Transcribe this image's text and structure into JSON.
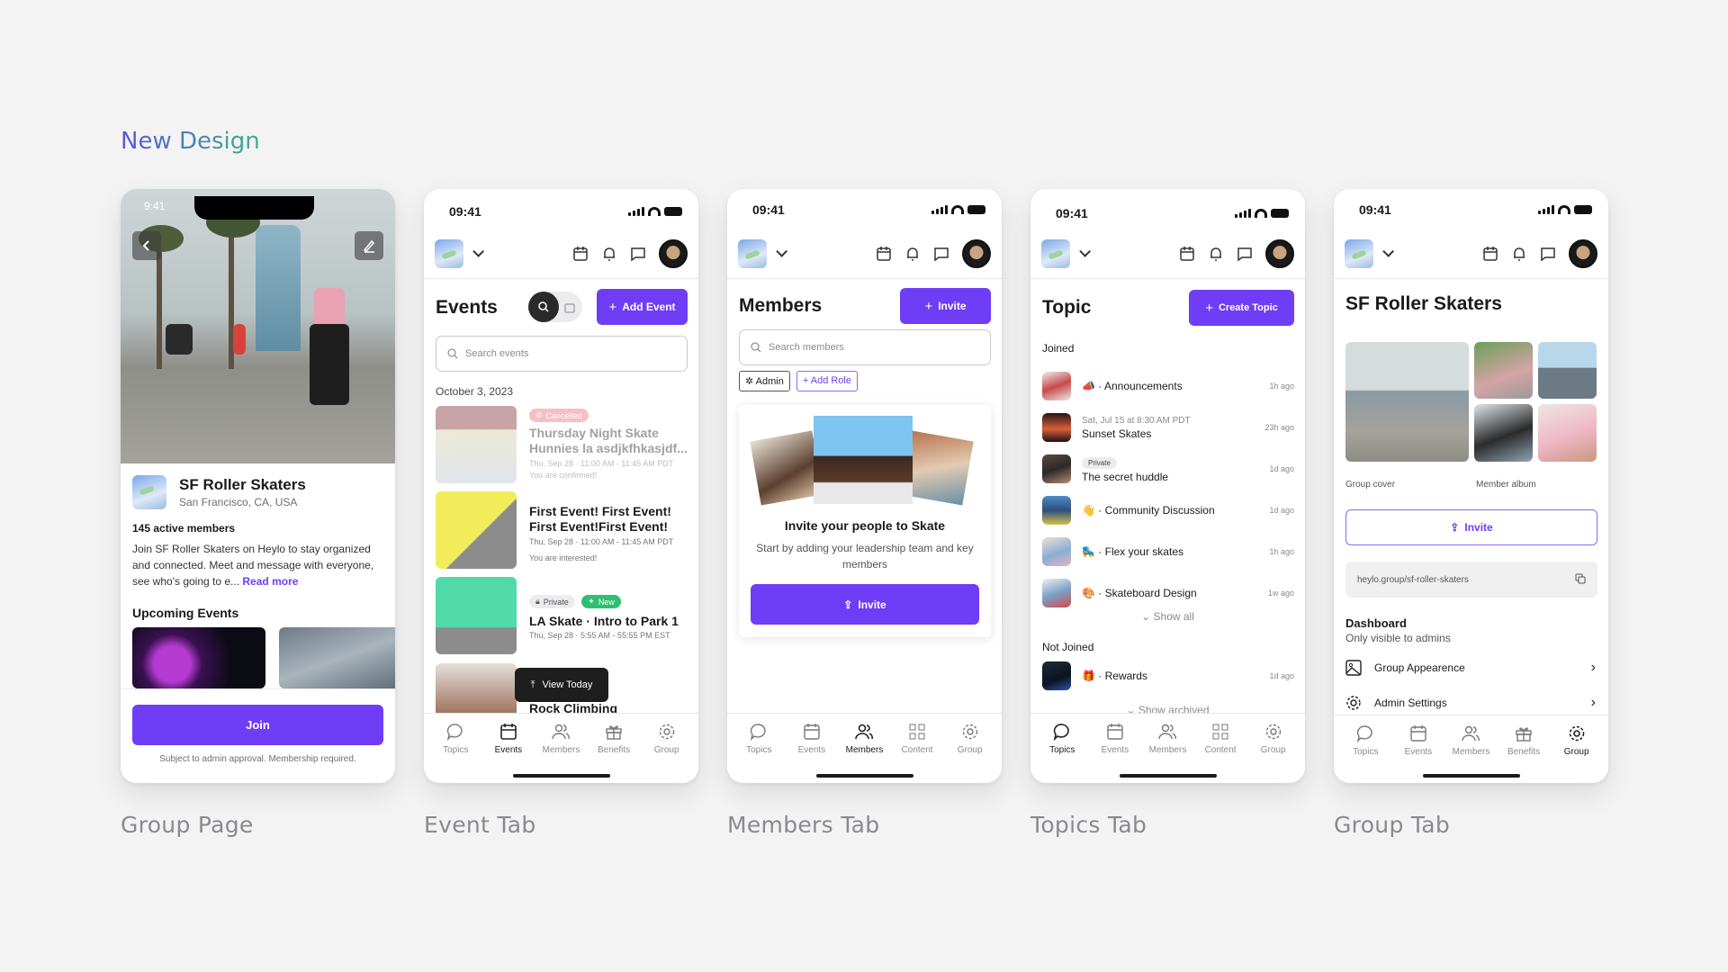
{
  "heading": "New Design",
  "captions": [
    "Group Page",
    "Event Tab",
    "Members Tab",
    "Topics Tab",
    "Group Tab"
  ],
  "colors": {
    "accent": "#6e3df5",
    "green": "#2fbf71",
    "cancelled": "#f28b95"
  },
  "status_time": "09:41",
  "status_time_group": "9:41",
  "tab_bar": {
    "events_tabs": [
      "Topics",
      "Events",
      "Members",
      "Benefits",
      "Group"
    ],
    "content_tabs": [
      "Topics",
      "Events",
      "Members",
      "Content",
      "Group"
    ]
  },
  "group_page": {
    "name": "SF Roller Skaters",
    "location": "San Francisco, CA, USA",
    "members": "145 active members",
    "description": "Join SF Roller Skaters on Heylo to stay organized and connected. Meet and message with everyone, see who's going to e...",
    "read_more": "Read more",
    "upcoming_title": "Upcoming Events",
    "join_label": "Join",
    "join_note": "Subject to admin approval. Membership required."
  },
  "events_tab": {
    "title": "Events",
    "add_label": "Add Event",
    "search_placeholder": "Search events",
    "date": "October 3, 2023",
    "events": [
      {
        "badges": [
          "Cancelled"
        ],
        "title": "Thursday Night Skate Hunnies la asdjkfhkasjdf...",
        "time": "Thu, Sep 28 · 11:00 AM - 11:45 AM PDT",
        "status": "You are confirmed!"
      },
      {
        "badges": [],
        "title": "First Event! First Event! First Event!First Event!",
        "time": "Thu, Sep 28 · 11:00 AM - 11:45 AM PDT",
        "status": "You are interested!"
      },
      {
        "badges": [
          "Private",
          "New"
        ],
        "title": "LA Skate · Intro to Park 1",
        "time": "Thu, Sep 28 · 5:55 AM - 55:55 PM EST",
        "status": ""
      },
      {
        "badges": [],
        "title": "Rock Climbing",
        "time": "",
        "status": ""
      }
    ],
    "view_today": "View Today"
  },
  "members_tab": {
    "title": "Members",
    "invite_label": "Invite",
    "search_placeholder": "Search members",
    "chips": [
      "Admin",
      "Add Role"
    ],
    "card_title": "Invite your people to Skate",
    "card_text": "Start by adding your leadership team and key members",
    "card_button": "Invite"
  },
  "topics_tab": {
    "title": "Topic",
    "create_label": "Create Topic",
    "joined_label": "Joined",
    "joined": [
      {
        "emoji": "📣",
        "name": "Announcements",
        "meta": "",
        "badge": "",
        "time": "1h ago"
      },
      {
        "emoji": "",
        "name": "Sunset Skates",
        "meta": "Sat, Jul 15 at 8:30 AM PDT",
        "badge": "",
        "time": "23h ago"
      },
      {
        "emoji": "",
        "name": "The secret huddle",
        "meta": "",
        "badge": "Private",
        "time": "1d ago"
      },
      {
        "emoji": "👋",
        "name": "Community Discussion",
        "meta": "",
        "badge": "",
        "time": "1d ago"
      },
      {
        "emoji": "🛼",
        "name": "Flex your skates",
        "meta": "",
        "badge": "",
        "time": "1h ago"
      },
      {
        "emoji": "🎨",
        "name": "Skateboard Design",
        "meta": "",
        "badge": "",
        "time": "1w ago"
      }
    ],
    "show_all": "Show all",
    "not_joined_label": "Not Joined",
    "not_joined": [
      {
        "emoji": "🎁",
        "name": "Rewards",
        "time": "1d ago"
      }
    ],
    "show_archived": "Show archived"
  },
  "group_tab": {
    "title": "SF Roller Skaters",
    "cover_label": "Group cover",
    "album_label": "Member album",
    "invite_label": "Invite",
    "link": "heylo.group/sf-roller-skaters",
    "dashboard_title": "Dashboard",
    "dashboard_sub": "Only visible to admins",
    "items": [
      "Group Appearence",
      "Admin Settings"
    ]
  }
}
